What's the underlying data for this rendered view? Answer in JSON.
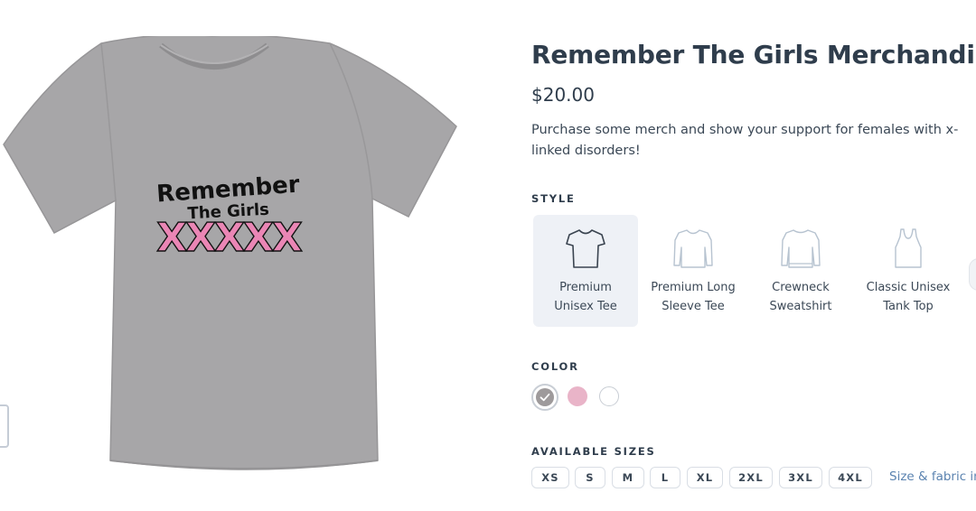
{
  "product": {
    "title": "Remember The Girls Merchandise",
    "price": "$20.00",
    "description": "Purchase some merch and show your support for females with x-linked disorders!",
    "shirt_graphic": {
      "line1": "Remember",
      "line2": "The Girls",
      "marks": "XXXXX"
    }
  },
  "style": {
    "label": "STYLE",
    "options": [
      {
        "name_line1": "Premium",
        "name_line2": "Unisex Tee",
        "icon": "tshirt-icon",
        "selected": true
      },
      {
        "name_line1": "Premium Long",
        "name_line2": "Sleeve Tee",
        "icon": "long-sleeve-icon",
        "selected": false
      },
      {
        "name_line1": "Crewneck",
        "name_line2": "Sweatshirt",
        "icon": "sweatshirt-icon",
        "selected": false
      },
      {
        "name_line1": "Classic Unisex",
        "name_line2": "Tank Top",
        "icon": "tank-top-icon",
        "selected": false
      }
    ]
  },
  "color": {
    "label": "COLOR",
    "swatches": [
      {
        "name": "heather-grey",
        "hex": "#9e9a9b",
        "selected": true
      },
      {
        "name": "pink",
        "hex": "#e9b4c8",
        "selected": false
      },
      {
        "name": "white",
        "hex": "#ffffff",
        "selected": false
      }
    ]
  },
  "sizes": {
    "label": "AVAILABLE SIZES",
    "options": [
      "XS",
      "S",
      "M",
      "L",
      "XL",
      "2XL",
      "3XL",
      "4XL"
    ],
    "link_text": "Size & fabric info"
  },
  "colors": {
    "text": "#2f3d4c",
    "link": "#5b83b0",
    "selected_bg": "#eef1f6",
    "icon_dark": "#3a4450",
    "icon_light": "#b7c3d0"
  }
}
